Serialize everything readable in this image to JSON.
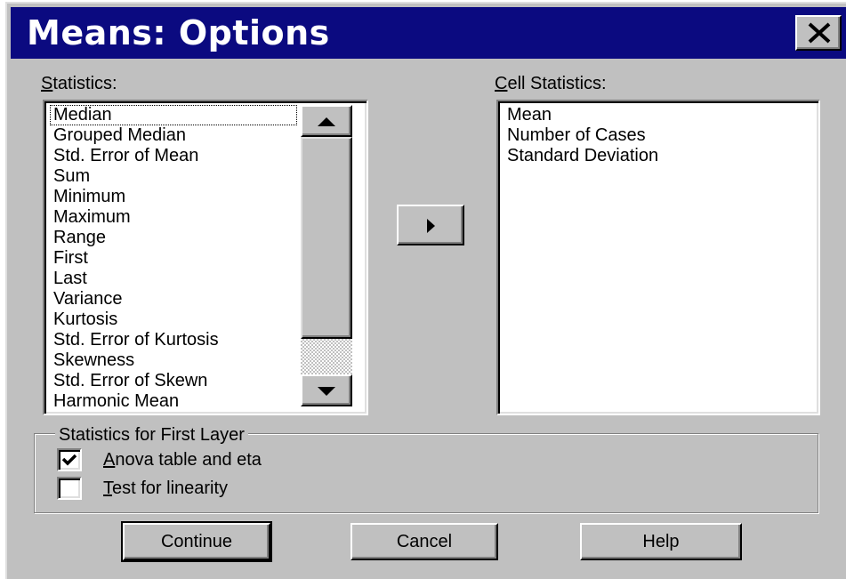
{
  "window": {
    "title": "Means: Options"
  },
  "statistics": {
    "label_mnemonic": "S",
    "label_rest": "tatistics:",
    "items": [
      "Median",
      "Grouped Median",
      "Std. Error of Mean",
      "Sum",
      "Minimum",
      "Maximum",
      "Range",
      "First",
      "Last",
      "Variance",
      "Kurtosis",
      "Std. Error of Kurtosis",
      "Skewness",
      "Std. Error of Skewn",
      "Harmonic Mean"
    ],
    "focused_index": 0
  },
  "cell_statistics": {
    "label_mnemonic": "C",
    "label_rest": "ell Statistics:",
    "items": [
      "Mean",
      "Number of Cases",
      "Standard Deviation"
    ]
  },
  "first_layer": {
    "title": "Statistics for First Layer",
    "anova": {
      "mnemonic": "A",
      "rest": "nova table and eta",
      "checked": true
    },
    "linearity": {
      "mnemonic": "T",
      "rest": "est for linearity",
      "checked": false
    }
  },
  "buttons": {
    "continue": "Continue",
    "cancel": "Cancel",
    "help": "Help"
  },
  "icons": {
    "close": "close-icon",
    "move_right": "right-arrow-icon",
    "scroll_up": "up-arrow-icon",
    "scroll_down": "down-arrow-icon",
    "check": "checkmark-icon"
  }
}
